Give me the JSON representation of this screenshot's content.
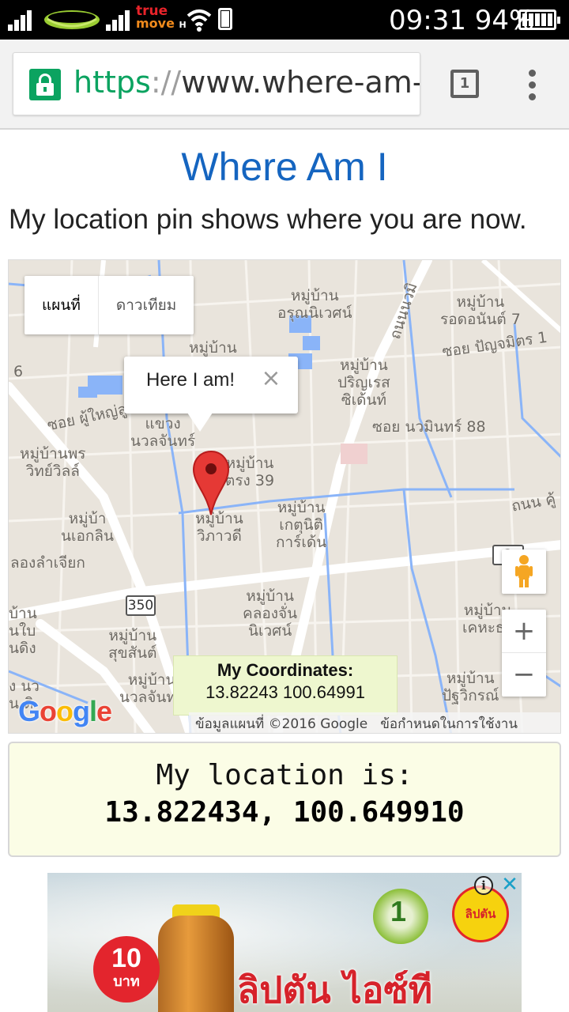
{
  "status_bar": {
    "carrier_logo": "truemove-logo-icon",
    "carrier_text_1": "true",
    "carrier_text_2": "move",
    "carrier_network": "H",
    "time": "09:31",
    "battery": "94%"
  },
  "browser": {
    "url_scheme": "https",
    "url_sep": "://",
    "url_rest": "www.where-am-",
    "tab_count": "1",
    "icons": {
      "lock": "lock-icon",
      "tabs": "tabs-icon",
      "menu": "overflow-menu-icon"
    }
  },
  "page": {
    "title": "Where Am I",
    "subtitle": "My location pin shows where you are now."
  },
  "map": {
    "map_type_map": "แผนที่",
    "map_type_satellite": "ดาวเทียม",
    "infowindow_text": "Here I am!",
    "infowindow_close": "×",
    "coords_heading": "My Coordinates:",
    "coords_value": "13.82243 100.64991",
    "google_logo": [
      "G",
      "o",
      "o",
      "g",
      "l",
      "e"
    ],
    "google_colors": [
      "#4285F4",
      "#EA4335",
      "#FBBC05",
      "#4285F4",
      "#34A853",
      "#EA4335"
    ],
    "attribution": "ข้อมูลแผนที่ ©2016 Google",
    "terms": "ข้อกำหนดในการใช้งาน",
    "zoom_in": "+",
    "zoom_out": "−",
    "road_number_1": "350",
    "road_number_2": "3",
    "labels": {
      "l1": "หมู่บ้าน\nอรุณนิเวศน์",
      "l2": "หมู่บ้าน\nรอดอนันต์ 7",
      "l3": "ซอย ปัญจมิตร 1",
      "l4": "หมู่บ้าน",
      "l5": "หมู่บ้าน\nปริญเรส\nซิเด้นท์",
      "l6": "ซอย ผู้ใหญ่ลู",
      "l7": "แขวง\nนวลจันทร์",
      "l8": "ซอย นวมินทร์ 88",
      "l9": "หมู่บ้านพร\nวิทย์วิลล์",
      "l10": "หมู่บ้าน\nตรง 39",
      "l11": "หมู่บ้าน\nเกตุนิติ\nการ์เด้น",
      "l12": "หมู่บ้า\nนเอกลิน",
      "l13": "หมู่บ้าน\nวิภาวดี",
      "l14": "ถนน คู้",
      "l15": "ลองลำเจียก",
      "l16": "หมู่บ้าน\nคลองจั่น\nนิเวศน์",
      "l17": "หมู่บ้าน\nเคหะธา",
      "l18": "บ้าน\nนใบ\nนดิง",
      "l19": "หมู่บ้าน\nสุขสันต์",
      "l20": "หมู่บ้าน\nนวลจันทร์",
      "l21": "หมู่บ้าน\nปัฐวิกรณ์",
      "l22": "ถนนนวมิ",
      "l23": "6",
      "l24": "ง นว\nน ดิ"
    },
    "pegman_icon": "pegman-icon",
    "pin_icon": "location-pin-icon"
  },
  "location_box": {
    "line1": "My location is:",
    "line2": "13.822434, 100.649910"
  },
  "ad": {
    "price_number": "10",
    "price_unit": "บาท",
    "brand_text": "ลิปตัน ไอซ์ที",
    "badge_text": "1",
    "lipton_text": "ลิปตัน",
    "info": "i",
    "close": "✕"
  },
  "colors": {
    "title": "#1565c0",
    "secure_green": "#0ba360",
    "map_bg": "#e9e4dc",
    "coords_bg": "#eef7cf",
    "location_bg": "#fbfde6",
    "pin_red": "#e53935"
  }
}
